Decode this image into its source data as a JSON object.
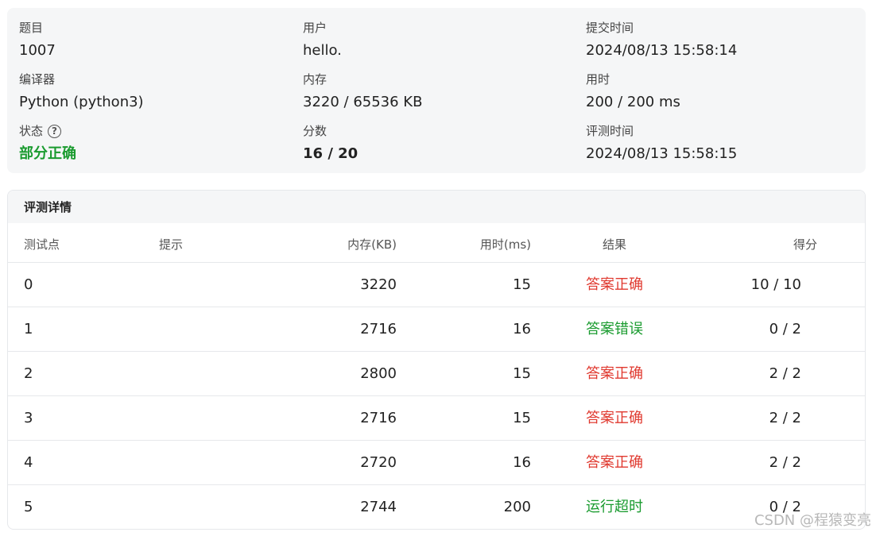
{
  "submission": {
    "problem_label": "题目",
    "problem_value": "1007",
    "user_label": "用户",
    "user_value": "hello.",
    "submit_time_label": "提交时间",
    "submit_time_value": "2024/08/13 15:58:14",
    "compiler_label": "编译器",
    "compiler_value": "Python (python3)",
    "memory_label": "内存",
    "memory_value": "3220 / 65536 KB",
    "time_label": "用时",
    "time_value": "200 / 200 ms",
    "status_label": "状态",
    "status_help_icon": "question-circle-icon",
    "status_value": "部分正确",
    "score_label": "分数",
    "score_value": "16 / 20",
    "judge_time_label": "评测时间",
    "judge_time_value": "2024/08/13 15:58:15"
  },
  "details": {
    "title": "评测详情",
    "columns": {
      "case": "测试点",
      "hint": "提示",
      "memory": "内存(KB)",
      "time": "用时(ms)",
      "result": "结果",
      "score": "得分"
    },
    "rows": [
      {
        "case": "0",
        "hint": "",
        "memory": "3220",
        "time": "15",
        "result": "答案正确",
        "score": "10 / 10"
      },
      {
        "case": "1",
        "hint": "",
        "memory": "2716",
        "time": "16",
        "result": "答案错误",
        "score": "0 / 2"
      },
      {
        "case": "2",
        "hint": "",
        "memory": "2800",
        "time": "15",
        "result": "答案正确",
        "score": "2 / 2"
      },
      {
        "case": "3",
        "hint": "",
        "memory": "2716",
        "time": "15",
        "result": "答案正确",
        "score": "2 / 2"
      },
      {
        "case": "4",
        "hint": "",
        "memory": "2720",
        "time": "16",
        "result": "答案正确",
        "score": "2 / 2"
      },
      {
        "case": "5",
        "hint": "",
        "memory": "2744",
        "time": "200",
        "result": "运行超时",
        "score": "0 / 2"
      }
    ]
  },
  "colors": {
    "accepted": "#e0392f",
    "rejected": "#1a9b2f",
    "partial": "#1a9b2f"
  },
  "watermark": "CSDN @程猿变亮"
}
